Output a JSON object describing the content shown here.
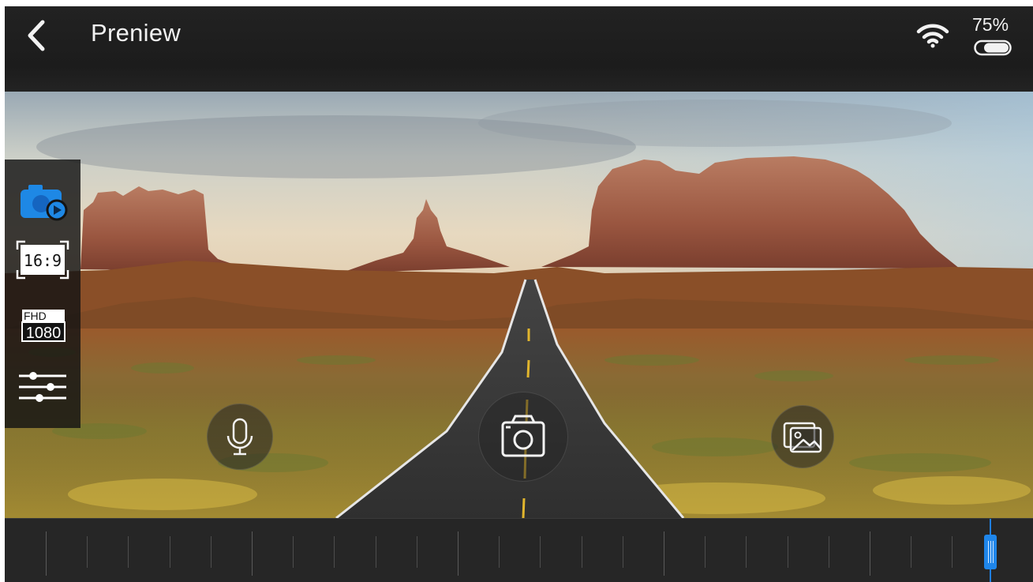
{
  "header": {
    "title": "Preniew",
    "back_icon": "chevron-left-icon",
    "wifi_icon": "wifi-icon",
    "battery_percent": "75%",
    "battery_icon": "battery-icon"
  },
  "side_menu": {
    "items": [
      {
        "name": "camera-mode",
        "icon": "camera-record-icon",
        "active": true,
        "color": "#1e88e5"
      },
      {
        "name": "aspect-ratio",
        "icon": "aspect-ratio-icon",
        "label": "16:9"
      },
      {
        "name": "resolution",
        "icon": "resolution-icon",
        "label_top": "FHD",
        "label_bottom": "1080"
      },
      {
        "name": "settings",
        "icon": "sliders-icon"
      }
    ]
  },
  "controls": {
    "mic_icon": "microphone-icon",
    "shutter_icon": "camera-icon",
    "gallery_icon": "gallery-icon"
  },
  "timeline": {
    "accent_color": "#1f86ea",
    "position": 0.958
  }
}
